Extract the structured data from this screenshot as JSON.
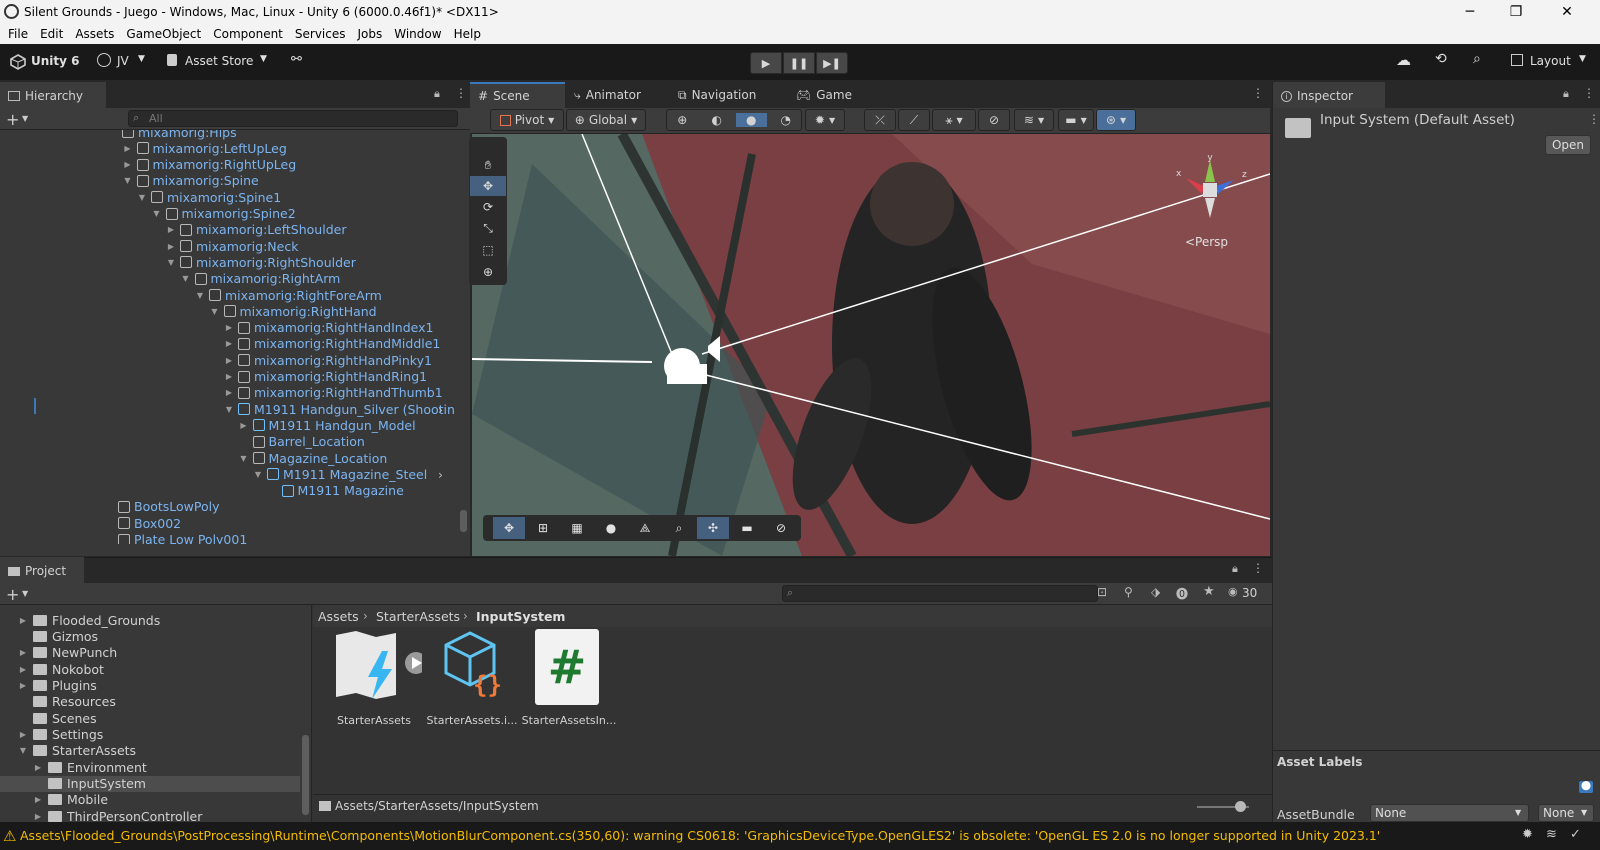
{
  "window": {
    "title": "Silent Grounds - Juego - Windows, Mac, Linux - Unity 6 (6000.0.46f1)* <DX11>",
    "minimize": "─",
    "maximize": "❐",
    "close": "✕"
  },
  "menu": [
    "File",
    "Edit",
    "Assets",
    "GameObject",
    "Component",
    "Services",
    "Jobs",
    "Window",
    "Help"
  ],
  "toolbar": {
    "unity_label": "Unity 6",
    "account": "JV",
    "asset_store": "Asset Store",
    "layout": "Layout"
  },
  "hierarchy": {
    "tab": "Hierarchy",
    "search_placeholder": "All",
    "rows": [
      {
        "label": "mixamorig:Hips",
        "arrow": "",
        "icon": "cube",
        "indent": 0
      },
      {
        "label": "mixamorig:LeftUpLeg",
        "arrow": "▶",
        "icon": "cube",
        "indent": 1
      },
      {
        "label": "mixamorig:RightUpLeg",
        "arrow": "▶",
        "icon": "cube",
        "indent": 1
      },
      {
        "label": "mixamorig:Spine",
        "arrow": "▼",
        "icon": "cube",
        "indent": 1
      },
      {
        "label": "mixamorig:Spine1",
        "arrow": "▼",
        "icon": "cube",
        "indent": 2
      },
      {
        "label": "mixamorig:Spine2",
        "arrow": "▼",
        "icon": "cube",
        "indent": 3
      },
      {
        "label": "mixamorig:LeftShoulder",
        "arrow": "▶",
        "icon": "cube",
        "indent": 4
      },
      {
        "label": "mixamorig:Neck",
        "arrow": "▶",
        "icon": "cube",
        "indent": 4
      },
      {
        "label": "mixamorig:RightShoulder",
        "arrow": "▼",
        "icon": "cube",
        "indent": 4
      },
      {
        "label": "mixamorig:RightArm",
        "arrow": "▼",
        "icon": "cube",
        "indent": 5
      },
      {
        "label": "mixamorig:RightForeArm",
        "arrow": "▼",
        "icon": "cube",
        "indent": 6
      },
      {
        "label": "mixamorig:RightHand",
        "arrow": "▼",
        "icon": "cube",
        "indent": 7
      },
      {
        "label": "mixamorig:RightHandIndex1",
        "arrow": "▶",
        "icon": "cube",
        "indent": 8
      },
      {
        "label": "mixamorig:RightHandMiddle1",
        "arrow": "▶",
        "icon": "cube",
        "indent": 8
      },
      {
        "label": "mixamorig:RightHandPinky1",
        "arrow": "▶",
        "icon": "cube",
        "indent": 8
      },
      {
        "label": "mixamorig:RightHandRing1",
        "arrow": "▶",
        "icon": "cube",
        "indent": 8
      },
      {
        "label": "mixamorig:RightHandThumb1",
        "arrow": "▶",
        "icon": "cube",
        "indent": 8
      },
      {
        "label": "M1911 Handgun_Silver (Shootin",
        "arrow": "▼",
        "icon": "prefab",
        "indent": 8
      },
      {
        "label": "M1911 Handgun_Model",
        "arrow": "▶",
        "icon": "prefab",
        "indent": 9
      },
      {
        "label": "Barrel_Location",
        "arrow": "",
        "icon": "cube",
        "indent": 9
      },
      {
        "label": "Magazine_Location",
        "arrow": "▼",
        "icon": "cube",
        "indent": 9
      },
      {
        "label": "M1911 Magazine_Steel",
        "arrow": "▼",
        "icon": "prefab",
        "indent": 10
      },
      {
        "label": "M1911 Magazine",
        "arrow": "",
        "icon": "prefab",
        "indent": 11
      },
      {
        "label": "BootsLowPoly",
        "arrow": "",
        "icon": "cube",
        "indent": -1
      },
      {
        "label": "Box002",
        "arrow": "",
        "icon": "cube",
        "indent": -1
      },
      {
        "label": "Plate Low Poly001",
        "arrow": "",
        "icon": "cube",
        "indent": -1
      }
    ]
  },
  "scene": {
    "tabs": [
      "Scene",
      "Animator",
      "Navigation",
      "Game"
    ],
    "pivot": "Pivot",
    "global": "Global",
    "persp": "<Persp",
    "gizmo_axes": [
      "y",
      "z",
      "x"
    ]
  },
  "inspector": {
    "tab": "Inspector",
    "asset_title": "Input System (Default Asset)",
    "open": "Open",
    "asset_labels": "Asset Labels",
    "assetbundle_label": "AssetBundle",
    "bundle_value": "None",
    "variant_value": "None"
  },
  "project": {
    "tab": "Project",
    "hidden_count": "30",
    "breadcrumb": [
      "Assets",
      "StarterAssets",
      "InputSystem"
    ],
    "tree": [
      {
        "label": "Flooded_Grounds",
        "arrow": "▶",
        "indent": 0
      },
      {
        "label": "Gizmos",
        "arrow": "",
        "indent": 0
      },
      {
        "label": "NewPunch",
        "arrow": "▶",
        "indent": 0
      },
      {
        "label": "Nokobot",
        "arrow": "▶",
        "indent": 0
      },
      {
        "label": "Plugins",
        "arrow": "▶",
        "indent": 0
      },
      {
        "label": "Resources",
        "arrow": "",
        "indent": 0
      },
      {
        "label": "Scenes",
        "arrow": "",
        "indent": 0
      },
      {
        "label": "Settings",
        "arrow": "▶",
        "indent": 0
      },
      {
        "label": "StarterAssets",
        "arrow": "▼",
        "indent": 0
      },
      {
        "label": "Environment",
        "arrow": "▶",
        "indent": 1
      },
      {
        "label": "InputSystem",
        "arrow": "",
        "indent": 1
      },
      {
        "label": "Mobile",
        "arrow": "▶",
        "indent": 1
      },
      {
        "label": "ThirdPersonController",
        "arrow": "▶",
        "indent": 1
      }
    ],
    "assets": [
      {
        "label": "StarterAssets",
        "kind": "inputactions"
      },
      {
        "label": "StarterAssets.i...",
        "kind": "asmdef"
      },
      {
        "label": "StarterAssetsIn...",
        "kind": "cs"
      }
    ],
    "footer_path": "Assets/StarterAssets/InputSystem"
  },
  "console": {
    "message": "Assets\\Flooded_Grounds\\PostProcessing\\Runtime\\Components\\MotionBlurComponent.cs(350,60): warning CS0618: 'GraphicsDeviceType.OpenGLES2' is obsolete: 'OpenGL ES 2.0 is no longer supported in Unity 2023.1'"
  },
  "colors": {
    "accent": "#3a79bb",
    "link": "#7bb4f0",
    "warning": "#f4bc02"
  }
}
